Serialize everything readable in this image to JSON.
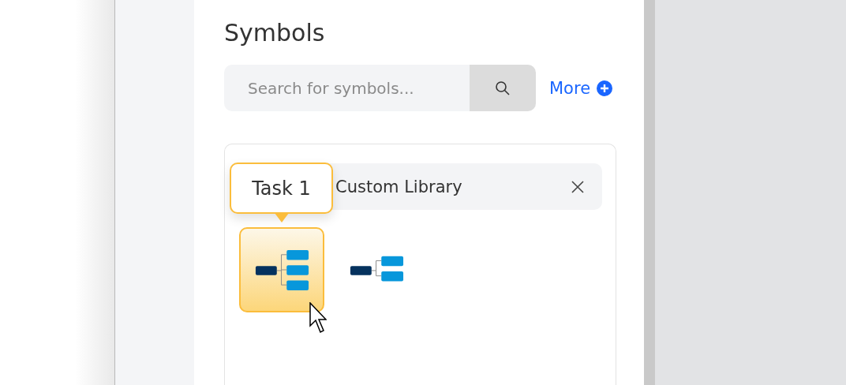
{
  "panel": {
    "title": "Symbols",
    "search": {
      "placeholder": "Search for symbols..."
    },
    "more_link": "More",
    "library": {
      "title": "Custom Library",
      "symbols": [
        {
          "kind": "three-branch",
          "selected": true,
          "tooltip": "Task 1"
        },
        {
          "kind": "two-branch",
          "selected": false
        }
      ]
    }
  }
}
